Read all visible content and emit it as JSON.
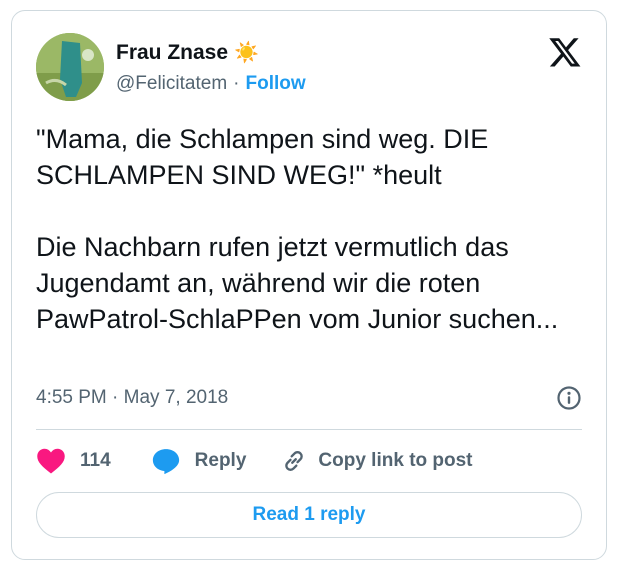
{
  "author": {
    "name": "Frau Znase",
    "emoji": "☀️",
    "handle": "@Felicitatem",
    "separator": "·",
    "follow_label": "Follow"
  },
  "tweet": {
    "text": "\"Mama, die Schlampen sind weg. DIE SCHLAMPEN SIND WEG!\" *heult\n\nDie Nachbarn rufen jetzt vermutlich das Jugendamt an, während wir die roten PawPatrol-SchlaPPen vom Junior suchen...",
    "timestamp": "4:55 PM · May 7, 2018"
  },
  "actions": {
    "like_count": "114",
    "reply_label": "Reply",
    "copy_label": "Copy link to post"
  },
  "read_reply_label": "Read 1 reply",
  "colors": {
    "accent": "#1d9bf0",
    "heart": "#f91880",
    "muted": "#536471",
    "border": "#cfd9de"
  },
  "icons": [
    "x-logo-icon",
    "sun-emoji-icon",
    "info-icon",
    "heart-icon",
    "reply-bubble-icon",
    "link-icon"
  ]
}
